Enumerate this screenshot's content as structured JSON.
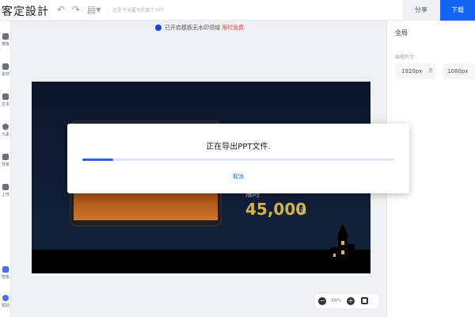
{
  "topbar": {
    "brand": "客定設計",
    "doc_title": "这是今天要写的那个PPT",
    "share_label": "分享",
    "download_label": "下载"
  },
  "sidebar": {
    "items": [
      {
        "label": "模板",
        "icon": "template-icon"
      },
      {
        "label": "素材",
        "icon": "grid-icon"
      },
      {
        "label": "文本",
        "icon": "text-icon"
      },
      {
        "label": "元素",
        "icon": "shapes-icon"
      },
      {
        "label": "背景",
        "icon": "background-icon"
      },
      {
        "label": "上传",
        "icon": "upload-icon"
      },
      {
        "label": "智能",
        "icon": "smart-icon"
      },
      {
        "label": "帮助",
        "icon": "help-icon"
      }
    ]
  },
  "notice": {
    "text": "已开启模板无水印领域",
    "link": "限时免费"
  },
  "slide": {
    "price_label": "限时",
    "price": "45,000",
    "price_unit": "元"
  },
  "zoom": {
    "value": "48%"
  },
  "rightpanel": {
    "title": "全局",
    "size_label": "画布尺寸",
    "width_value": "1920px",
    "height_value": "1080px",
    "width_unit": "宽",
    "height_unit": "高"
  },
  "modal": {
    "message": "正在导出PPT文件.",
    "progress": 0.1,
    "cancel_label": "取消"
  },
  "colors": {
    "accent": "#1464f6",
    "progress": "#2164e9",
    "price": "#d3b44a",
    "notice_link": "#e5484d"
  }
}
